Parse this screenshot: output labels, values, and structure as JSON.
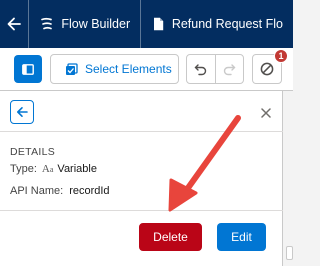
{
  "topbar": {
    "back_icon": "arrow-left-icon",
    "app_icon": "flow-icon",
    "app_label": "Flow Builder",
    "doc_icon": "file-icon",
    "doc_label": "Refund Request Flo"
  },
  "toolbar": {
    "toggle_icon": "panel-toggle-icon",
    "select_label": "Select Elements",
    "select_icon": "select-icon",
    "undo_icon": "undo-icon",
    "redo_icon": "redo-icon",
    "check_icon": "block-icon",
    "badge_count": "1"
  },
  "panel": {
    "details_heading": "DETAILS",
    "type_label": "Type:",
    "type_icon_text": "A",
    "type_icon_sub": "a",
    "type_value": "Variable",
    "api_label": "API Name:",
    "api_value": "recordId",
    "delete_label": "Delete",
    "edit_label": "Edit"
  },
  "colors": {
    "navy": "#032d60",
    "brand": "#0176d3",
    "delete": "#ba0517",
    "annotation": "#e8453c"
  }
}
